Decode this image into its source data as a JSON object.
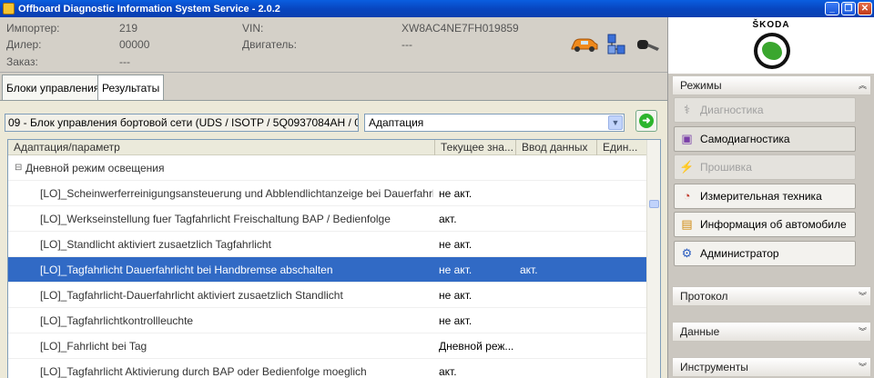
{
  "window": {
    "title": "Offboard Diagnostic Information System Service - 2.0.2",
    "minimize": "_",
    "restore": "❐",
    "close": "✕"
  },
  "vehicle_info": {
    "importer_label": "Импортер:",
    "importer_value": "219",
    "dealer_label": "Дилер:",
    "dealer_value": "00000",
    "order_label": "Заказ:",
    "order_value": "---",
    "vin_label": "VIN:",
    "vin_value": "XW8AC4NE7FH019859",
    "engine_label": "Двигатель:",
    "engine_value": "---"
  },
  "brand": {
    "name": "ŠKODA"
  },
  "tabs": [
    {
      "label": "Блоки управления"
    },
    {
      "label": "Результаты"
    }
  ],
  "control_unit": {
    "text": "09 - Блок управления бортовой сети  (UDS / ISOTP / 5Q0937084AH / 0",
    "mode_value": "Адаптация"
  },
  "grid": {
    "columns": [
      "Адаптация/параметр",
      "Текущее зна...",
      "Ввод данных",
      "Един..."
    ],
    "group_label": "Дневной режим освещения",
    "rows": [
      {
        "param": "[LO]_Scheinwerferreinigungsansteuerung und Abblendlichtanzeige bei Dauerfahrl",
        "current": "не акт.",
        "input": "",
        "unit": ""
      },
      {
        "param": "[LO]_Werkseinstellung fuer Tagfahrlicht Freischaltung BAP / Bedienfolge",
        "current": "акт.",
        "input": "",
        "unit": ""
      },
      {
        "param": "[LO]_Standlicht aktiviert zusaetzlich Tagfahrlicht",
        "current": "не акт.",
        "input": "",
        "unit": ""
      },
      {
        "param": "[LO]_Tagfahrlicht Dauerfahrlicht bei Handbremse abschalten",
        "current": "не акт.",
        "input": "акт.",
        "unit": ""
      },
      {
        "param": "[LO]_Tagfahrlicht-Dauerfahrlicht aktiviert zusaetzlich Standlicht",
        "current": "не акт.",
        "input": "",
        "unit": ""
      },
      {
        "param": "[LO]_Tagfahrlichtkontrollleuchte",
        "current": "не акт.",
        "input": "",
        "unit": ""
      },
      {
        "param": "[LO]_Fahrlicht bei Tag",
        "current": "Дневной реж...",
        "input": "",
        "unit": ""
      },
      {
        "param": "[LO]_Tagfahrlicht Aktivierung durch BAP oder Bedienfolge moeglich",
        "current": "акт.",
        "input": "",
        "unit": ""
      }
    ],
    "selected_row": 3
  },
  "sidebar": {
    "modes_title": "Режимы",
    "buttons": [
      {
        "label": "Диагностика",
        "icon": "stethoscope-icon",
        "enabled": false
      },
      {
        "label": "Самодиагностика",
        "icon": "self-diagnosis-icon",
        "enabled": true
      },
      {
        "label": "Прошивка",
        "icon": "flash-icon",
        "enabled": false
      },
      {
        "label": "Измерительная техника",
        "icon": "gauge-icon",
        "enabled": true
      },
      {
        "label": "Информация об автомобиле",
        "icon": "books-icon",
        "enabled": true
      },
      {
        "label": "Администратор",
        "icon": "gear-icon",
        "enabled": true
      }
    ],
    "protocol_title": "Протокол",
    "data_title": "Данные",
    "tools_title": "Инструменты"
  },
  "colors": {
    "titlebar": "#0a4fd0",
    "selection": "#316ac5",
    "skoda_green": "#3aa62e"
  }
}
